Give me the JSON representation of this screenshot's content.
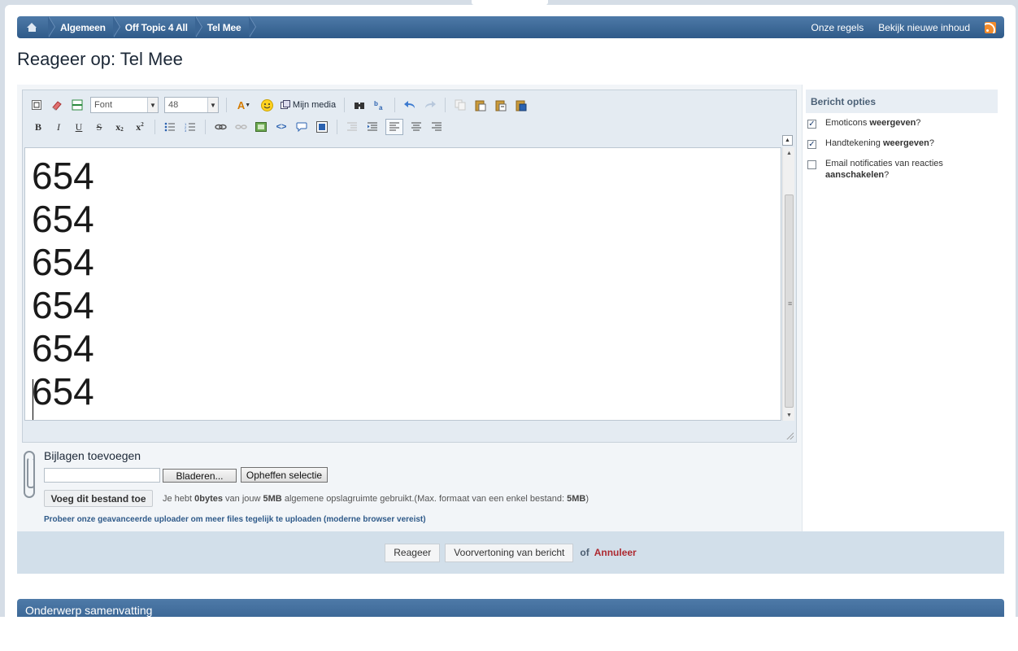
{
  "breadcrumb": {
    "items": [
      "Algemeen",
      "Off Topic 4 All"
    ],
    "current": "Tel Mee",
    "right_links": [
      "Onze regels",
      "Bekijk nieuwe inhoud"
    ]
  },
  "page_title": "Reageer op: Tel Mee",
  "editor": {
    "font_select": "Font",
    "size_select": "48",
    "media_label": "Mijn media",
    "content_lines": [
      "654",
      "654",
      "654",
      "654",
      "654",
      "654"
    ]
  },
  "attachments": {
    "title": "Bijlagen toevoegen",
    "browse_label": "Bladeren...",
    "clear_label": "Opheffen selectie",
    "add_label": "Voeg dit bestand toe",
    "quota_prefix": "Je hebt ",
    "quota_used": "0bytes",
    "quota_mid": " van jouw ",
    "quota_total": "5MB",
    "quota_mid2": " algemene opslagruimte gebruikt.(Max. formaat van een enkel bestand: ",
    "quota_max": "5MB",
    "quota_suffix": ")",
    "advanced_link": "Probeer onze geavanceerde uploader om meer files tegelijk te uploaden (moderne browser vereist)"
  },
  "options": {
    "title": "Bericht opties",
    "items": [
      {
        "pre": "Emoticons ",
        "bold": "weergeven",
        "post": "?",
        "checked": true
      },
      {
        "pre": "Handtekening ",
        "bold": "weergeven",
        "post": "?",
        "checked": true
      },
      {
        "pre": "Email notificaties van reacties ",
        "bold": "aanschakelen",
        "post": "?",
        "checked": false
      }
    ]
  },
  "submit": {
    "reply_label": "Reageer",
    "preview_label": "Voorvertoning van bericht",
    "or_label": "of",
    "cancel_label": "Annuleer"
  },
  "summary_title": "Onderwerp samenvatting",
  "colors": {
    "header_blue": "#2f5a89",
    "cancel_red": "#ad2930",
    "submit_bar": "#d2dfea"
  }
}
